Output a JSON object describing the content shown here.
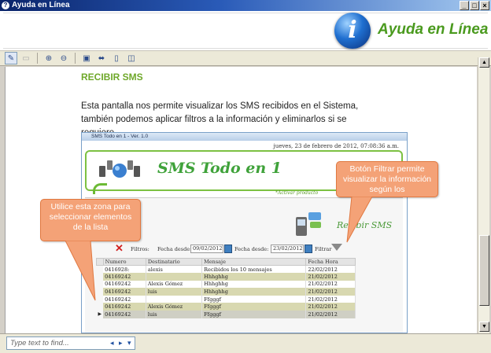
{
  "window": {
    "title": "Ayuda en Línea",
    "controls": [
      "_",
      "□",
      "×"
    ]
  },
  "header": {
    "help_title": "Ayuda en Línea",
    "info_glyph": "i"
  },
  "toolbar": {
    "buttons": [
      "hide-pane-icon",
      "back-icon",
      "zoom-in-icon",
      "zoom-out-icon",
      "fit-page-icon",
      "fit-width-icon",
      "single-page-icon",
      "two-page-icon"
    ]
  },
  "content": {
    "section_title": "RECIBIR SMS",
    "paragraph": "Esta pantalla nos permite visualizar los SMS recibidos en el Sistema, también podemos aplicar filtros a  la información y eliminarlos si se requiere."
  },
  "screenshot": {
    "window_title": "SMS Todo en 1 - Ver. 1.0",
    "date": "jueves, 23 de febrero de 2012,  07:08:36 a.m.",
    "app_title": "SMS Todo en 1",
    "activar": "*Activar producto",
    "section": "Recibir SMS",
    "filters_label": "Filtros:",
    "fecha_desde_1": "Fecha desde:",
    "date_1": "09/02/2012",
    "fecha_desde_2": "Fecha desde:",
    "date_2": "23/02/2012",
    "filtrar_label": "Filtrar",
    "columns": [
      "Numero",
      "Destinatario",
      "Mensaje",
      "Fecha Hora"
    ],
    "rows": [
      [
        "0416928:",
        "alexis",
        "Recibidos los 10 mensajes",
        "22/02/2012"
      ],
      [
        "04169242",
        "",
        "Hhhghhg",
        "21/02/2012"
      ],
      [
        "04169242",
        "Alexis Gómez",
        "Hhhghhg",
        "21/02/2012"
      ],
      [
        "04169242",
        "luis",
        "Hhhghhg",
        "21/02/2012"
      ],
      [
        "04169242",
        "",
        "Ffgggf",
        "21/02/2012"
      ],
      [
        "04169242",
        "Alexis Gómez",
        "Ffgggf",
        "21/02/2012"
      ],
      [
        "04169242",
        "luis",
        "Ffgggf",
        "21/02/2012"
      ]
    ]
  },
  "callouts": {
    "left": "Utilice esta zona para seleccionar elementos de la lista",
    "right": "Botón Filtrar permite visualizar la información según los"
  },
  "findbar": {
    "placeholder": "Type text to find...",
    "prev": "◂",
    "next": "▸",
    "dropdown": "▾"
  }
}
